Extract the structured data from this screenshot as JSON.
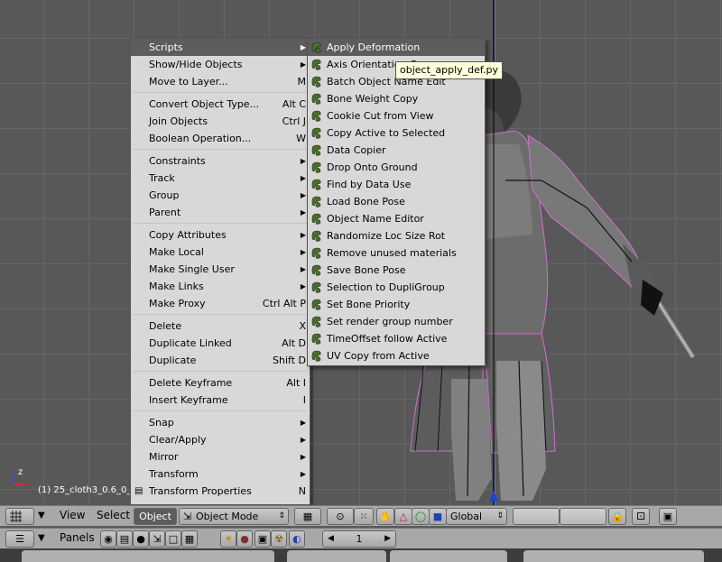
{
  "viewport": {
    "object_label": "(1) 25_cloth3_0.6_0_0"
  },
  "main_menu": {
    "items": [
      {
        "label": "Scripts",
        "shortcut": "",
        "has_sub": true
      },
      {
        "label": "Show/Hide Objects",
        "shortcut": "",
        "has_sub": true
      },
      {
        "label": "Move to Layer...",
        "shortcut": "M",
        "has_sub": false
      },
      {
        "label": "Convert Object Type...",
        "shortcut": "Alt C",
        "has_sub": false
      },
      {
        "label": "Join Objects",
        "shortcut": "Ctrl J",
        "has_sub": false
      },
      {
        "label": "Boolean Operation...",
        "shortcut": "W",
        "has_sub": false
      },
      {
        "label": "Constraints",
        "shortcut": "",
        "has_sub": true
      },
      {
        "label": "Track",
        "shortcut": "",
        "has_sub": true
      },
      {
        "label": "Group",
        "shortcut": "",
        "has_sub": true
      },
      {
        "label": "Parent",
        "shortcut": "",
        "has_sub": true
      },
      {
        "label": "Copy Attributes",
        "shortcut": "",
        "has_sub": true
      },
      {
        "label": "Make Local",
        "shortcut": "",
        "has_sub": true
      },
      {
        "label": "Make Single User",
        "shortcut": "",
        "has_sub": true
      },
      {
        "label": "Make Links",
        "shortcut": "",
        "has_sub": true
      },
      {
        "label": "Make Proxy",
        "shortcut": "Ctrl Alt P",
        "has_sub": false
      },
      {
        "label": "Delete",
        "shortcut": "X",
        "has_sub": false
      },
      {
        "label": "Duplicate Linked",
        "shortcut": "Alt D",
        "has_sub": false
      },
      {
        "label": "Duplicate",
        "shortcut": "Shift D",
        "has_sub": false
      },
      {
        "label": "Delete Keyframe",
        "shortcut": "Alt I",
        "has_sub": false
      },
      {
        "label": "Insert Keyframe",
        "shortcut": "I",
        "has_sub": false
      },
      {
        "label": "Snap",
        "shortcut": "",
        "has_sub": true
      },
      {
        "label": "Clear/Apply",
        "shortcut": "",
        "has_sub": true
      },
      {
        "label": "Mirror",
        "shortcut": "",
        "has_sub": true
      },
      {
        "label": "Transform",
        "shortcut": "",
        "has_sub": true
      },
      {
        "label": "Transform Properties",
        "shortcut": "N",
        "has_sub": false
      }
    ]
  },
  "scripts_menu": {
    "items": [
      "Apply Deformation",
      "Axis Orientation Copy",
      "Batch Object Name Edit",
      "Bone Weight Copy",
      "Cookie Cut from View",
      "Copy Active to Selected",
      "Data Copier",
      "Drop Onto Ground",
      "Find by Data Use",
      "Load Bone Pose",
      "Object Name Editor",
      "Randomize Loc Size Rot",
      "Remove unused materials",
      "Save Bone Pose",
      "Selection to DupliGroup",
      "Set Bone Priority",
      "Set render group number",
      "TimeOffset follow Active",
      "UV Copy from Active"
    ]
  },
  "tooltip": {
    "text": "object_apply_def.py"
  },
  "header": {
    "view": "View",
    "select": "Select",
    "object": "Object",
    "mode": "Object Mode",
    "orientation": "Global"
  },
  "buttons_header": {
    "panels": "Panels",
    "frame": "1"
  }
}
